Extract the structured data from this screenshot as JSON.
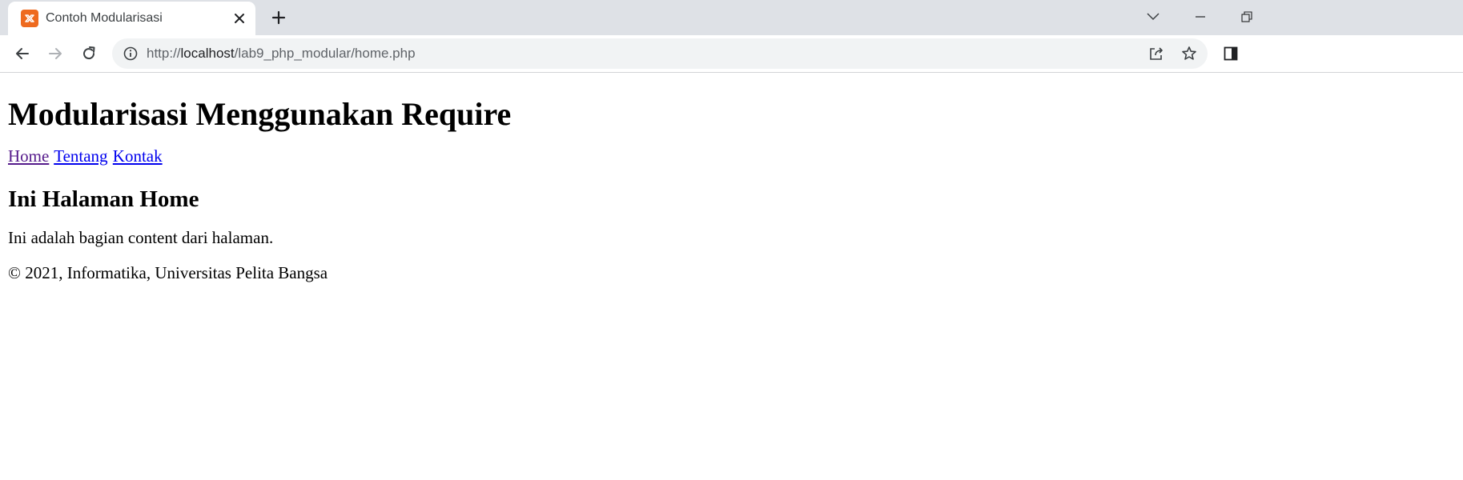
{
  "browser": {
    "tab": {
      "title": "Contoh Modularisasi",
      "favicon": "xampp-icon"
    },
    "new_tab_icon": "plus-icon",
    "address_bar": {
      "scheme": "http://",
      "host": "localhost",
      "path": "/lab9_php_modular/home.php"
    },
    "icons": {
      "back": "back-arrow-icon",
      "forward": "forward-arrow-icon",
      "reload": "reload-icon",
      "info": "info-icon",
      "share": "share-icon",
      "bookmark": "star-icon",
      "side_panel": "side-panel-icon",
      "tab_search": "chevron-down-icon",
      "minimize": "minimize-icon",
      "restore": "restore-icon"
    },
    "colors": {
      "tabstrip_bg": "#dee1e6",
      "omnibox_bg": "#f1f3f4",
      "favicon": "#ee6a1f"
    }
  },
  "page": {
    "heading": "Modularisasi Menggunakan Require",
    "nav": [
      {
        "label": "Home",
        "visited": true
      },
      {
        "label": "Tentang",
        "visited": false
      },
      {
        "label": "Kontak",
        "visited": false
      }
    ],
    "subheading": "Ini Halaman Home",
    "content": "Ini adalah bagian content dari halaman.",
    "footer": "© 2021, Informatika, Universitas Pelita Bangsa"
  }
}
